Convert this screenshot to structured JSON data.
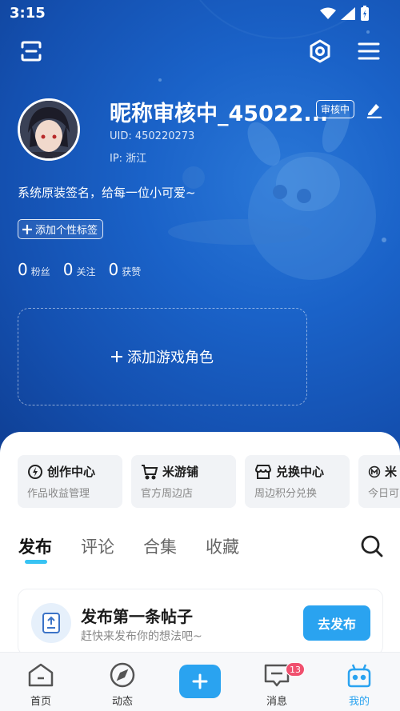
{
  "status_bar": {
    "time": "3:15"
  },
  "profile": {
    "nickname": "昵称审核中_45022...",
    "review_badge": "审核中",
    "uid": "UID: 450220273",
    "ip": "IP: 浙江",
    "signature": "系统原装签名，给每一位小可爱~",
    "add_tag_label": "添加个性标签",
    "stats": [
      {
        "value": "0",
        "label": "粉丝"
      },
      {
        "value": "0",
        "label": "关注"
      },
      {
        "value": "0",
        "label": "获赞"
      }
    ],
    "add_role_label": "添加游戏角色"
  },
  "quick_cards": [
    {
      "title": "创作中心",
      "subtitle": "作品收益管理",
      "icon": "bolt-icon"
    },
    {
      "title": "米游铺",
      "subtitle": "官方周边店",
      "icon": "cart-icon"
    },
    {
      "title": "兑换中心",
      "subtitle": "周边积分兑换",
      "icon": "store-icon"
    },
    {
      "title": "米",
      "subtitle": "今日可",
      "icon": "m-icon"
    }
  ],
  "tabs": [
    {
      "label": "发布",
      "active": true
    },
    {
      "label": "评论",
      "active": false
    },
    {
      "label": "合集",
      "active": false
    },
    {
      "label": "收藏",
      "active": false
    }
  ],
  "post_prompt": {
    "title": "发布第一条帖子",
    "subtitle": "赶快来发布你的想法吧~",
    "button": "去发布"
  },
  "bottom_nav": [
    {
      "label": "首页",
      "icon": "home-icon"
    },
    {
      "label": "动态",
      "icon": "compass-icon"
    },
    {
      "label": "",
      "icon": "plus-icon"
    },
    {
      "label": "消息",
      "icon": "message-icon",
      "badge": "13"
    },
    {
      "label": "我的",
      "icon": "profile-icon",
      "active": true
    }
  ],
  "colors": {
    "accent": "#2aa3f0",
    "hero": "#1a62c8",
    "badge": "#f0506e",
    "tab_underline": "#38c3f3"
  }
}
